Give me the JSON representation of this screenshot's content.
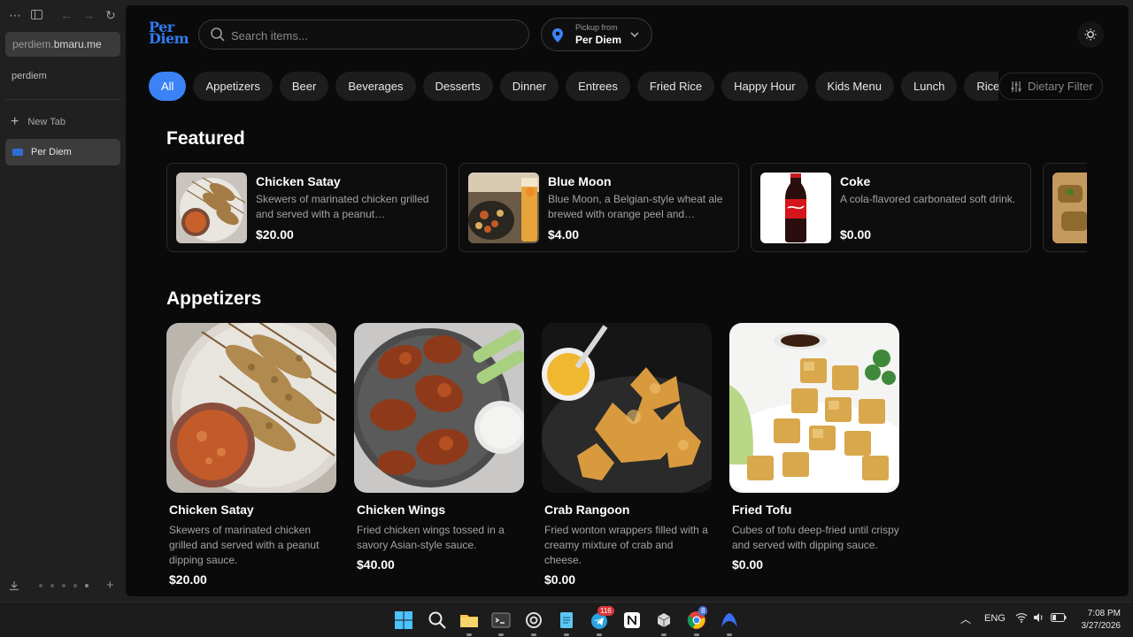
{
  "browser": {
    "url_host_prefix": "perdiem.",
    "url_host_domain": "bmaru.me",
    "section_label": "perdiem",
    "new_tab_label": "New Tab",
    "active_tab_label": "Per Diem"
  },
  "header": {
    "logo_line1": "Per",
    "logo_line2": "Diem",
    "search_placeholder": "Search items...",
    "pickup_label": "Pickup from",
    "pickup_location": "Per Diem"
  },
  "categories": [
    "All",
    "Appetizers",
    "Beer",
    "Beverages",
    "Desserts",
    "Dinner",
    "Entrees",
    "Fried Rice",
    "Happy Hour",
    "Kids Menu",
    "Lunch",
    "Rice Di"
  ],
  "dietary_filter_label": "Dietary Filter",
  "featured": {
    "title": "Featured",
    "items": [
      {
        "name": "Chicken Satay",
        "desc": "Skewers of marinated chicken grilled and served with a peanut…",
        "price": "$20.00"
      },
      {
        "name": "Blue Moon",
        "desc": "Blue Moon, a Belgian-style wheat ale brewed with orange peel and…",
        "price": "$4.00"
      },
      {
        "name": "Coke",
        "desc": "A cola-flavored carbonated soft drink.",
        "price": "$0.00"
      }
    ]
  },
  "appetizers": {
    "title": "Appetizers",
    "items": [
      {
        "name": "Chicken Satay",
        "desc": "Skewers of marinated chicken grilled and served with a peanut dipping sauce.",
        "price": "$20.00"
      },
      {
        "name": "Chicken Wings",
        "desc": "Fried chicken wings tossed in a savory Asian-style sauce.",
        "price": "$40.00"
      },
      {
        "name": "Crab Rangoon",
        "desc": "Fried wonton wrappers filled with a creamy mixture of crab and cheese.",
        "price": "$0.00"
      },
      {
        "name": "Fried Tofu",
        "desc": "Cubes of tofu deep-fried until crispy and served with dipping sauce.",
        "price": "$0.00"
      }
    ]
  },
  "taskbar": {
    "telegram_badge": "116",
    "chrome_badge": "8",
    "language": "ENG",
    "time": "7:08 PM",
    "date": "3/27/2026"
  },
  "colors": {
    "accent": "#3b82f6",
    "page_bg": "#0a0a0a",
    "sidebar_bg": "#202020"
  }
}
